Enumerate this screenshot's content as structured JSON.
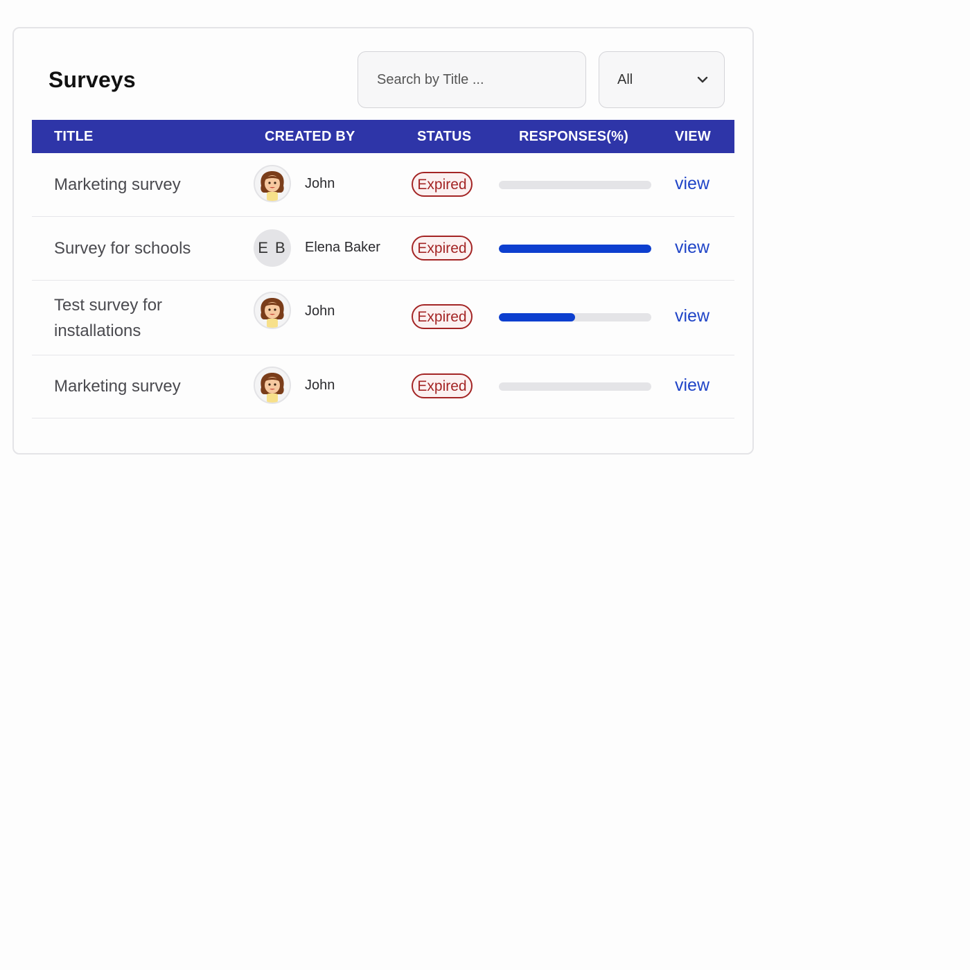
{
  "header": {
    "title": "Surveys"
  },
  "search": {
    "placeholder": "Search by Title ...",
    "value": ""
  },
  "filter": {
    "selected": "All"
  },
  "table": {
    "columns": [
      "TITLE",
      "CREATED BY",
      "STATUS",
      "RESPONSES(%)",
      "VIEW"
    ],
    "rows": [
      {
        "title": "Marketing survey",
        "creator": "John",
        "avatar": "cartoon-girl-icon",
        "status": "Expired",
        "responses_pct": 0,
        "view": "view"
      },
      {
        "title": "Survey for schools",
        "creator": "Elena Baker",
        "initials": "E B",
        "status": "Expired",
        "responses_pct": 100,
        "view": "view"
      },
      {
        "title": "Test survey for installations",
        "creator": "John",
        "avatar": "cartoon-girl-icon",
        "status": "Expired",
        "responses_pct": 50,
        "view": "view"
      },
      {
        "title": "Marketing survey",
        "creator": "John",
        "avatar": "cartoon-girl-icon",
        "status": "Expired",
        "responses_pct": 0,
        "view": "view"
      }
    ]
  },
  "colors": {
    "header_bg": "#2e35a8",
    "progress": "#0d3fcf",
    "expired": "#a32424",
    "link": "#1f44c7"
  }
}
